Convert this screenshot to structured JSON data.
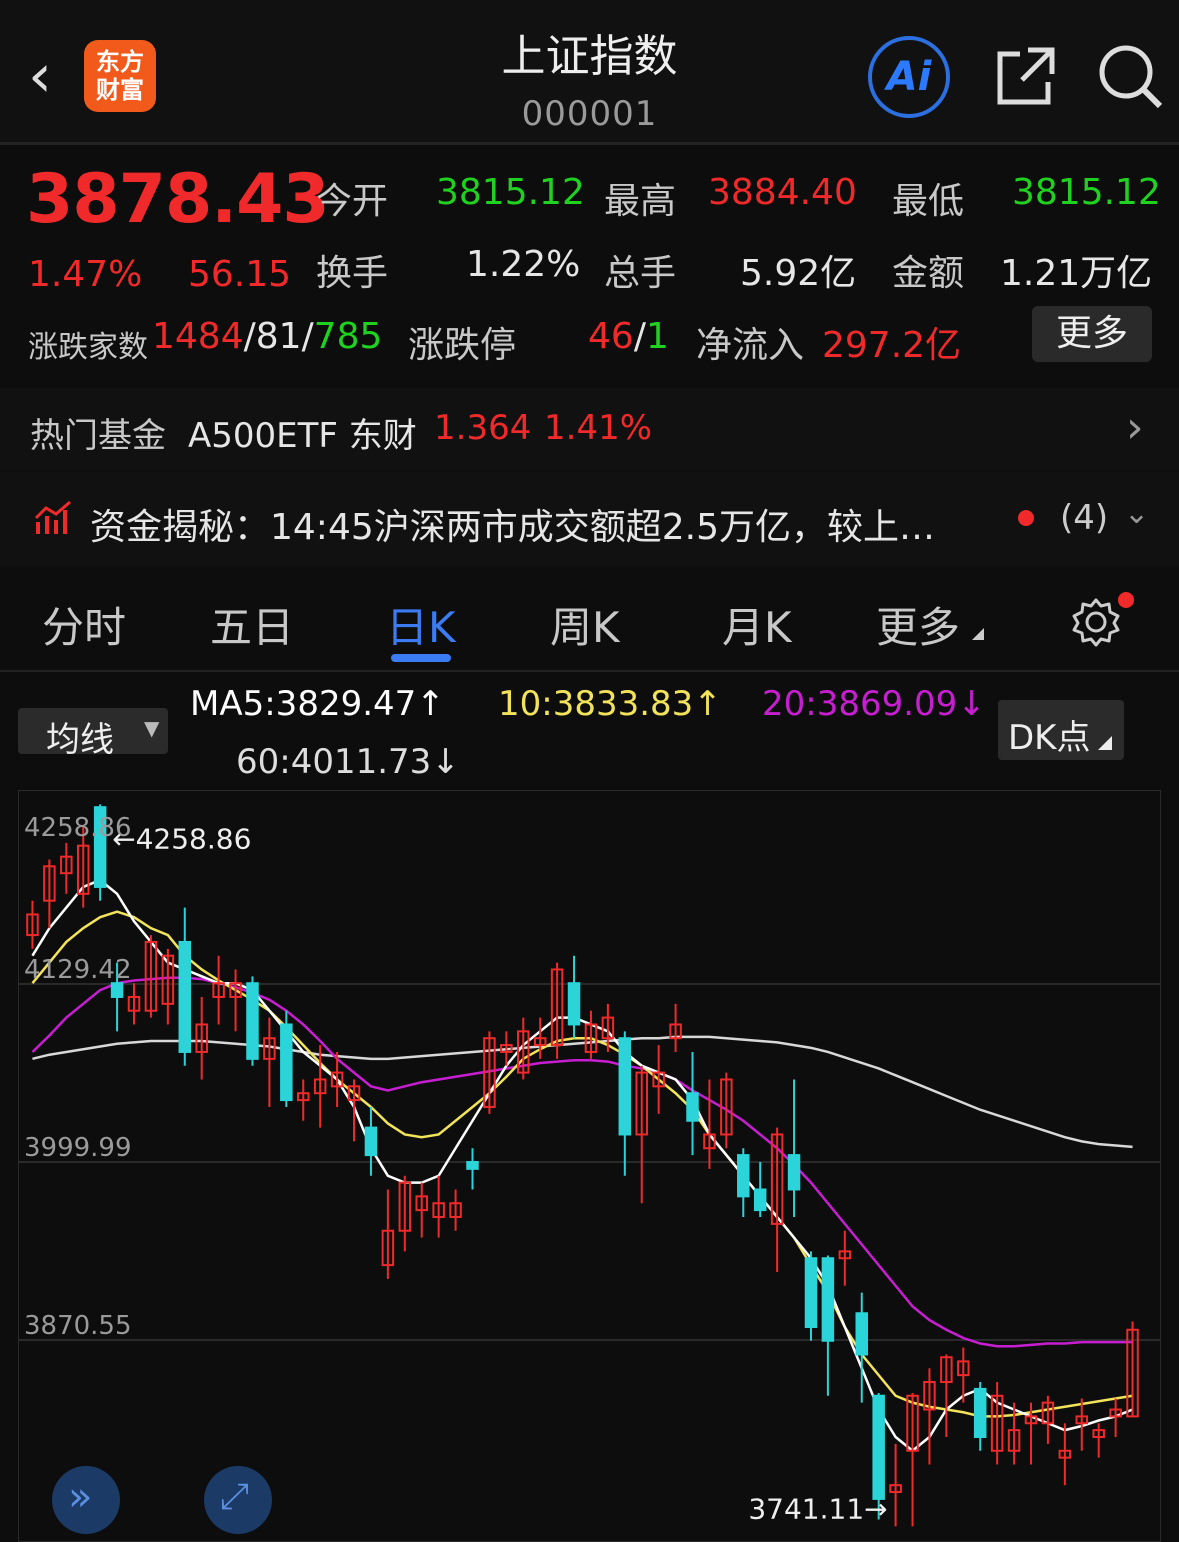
{
  "header": {
    "title": "上证指数",
    "code": "000001",
    "logo_line1": "东方",
    "logo_line2": "财富",
    "ai_label": "Ai"
  },
  "quote": {
    "price": "3878.43",
    "change_pct": "1.47%",
    "change": "56.15",
    "open_label": "今开",
    "open": "3815.12",
    "high_label": "最高",
    "high": "3884.40",
    "low_label": "最低",
    "low": "3815.12",
    "turnover_label": "换手",
    "turnover": "1.22%",
    "volume_label": "总手",
    "volume": "5.92亿",
    "amount_label": "金额",
    "amount": "1.21万亿",
    "breadth_label": "涨跌家数",
    "up": "1484",
    "flat": "81",
    "down": "785",
    "limit_label": "涨跌停",
    "limit_up": "46",
    "limit_down": "1",
    "inflow_label": "净流入",
    "inflow": "297.2亿",
    "more_label": "更多",
    "sep": "/"
  },
  "fund": {
    "label": "热门基金",
    "name": "A500ETF 东财",
    "price": "1.364",
    "pct": "1.41%"
  },
  "news": {
    "text": "资金揭秘：14:45沪深两市成交额超2.5万亿，较上…",
    "count": "(4)"
  },
  "tabs": [
    "分时",
    "五日",
    "日K",
    "周K",
    "月K",
    "更多"
  ],
  "active_tab": "日K",
  "ma_bar": {
    "select_label": "均线",
    "ma5": "MA5:3829.47↑",
    "ma10": "10:3833.83↑",
    "ma20": "20:3869.09↓",
    "ma60": "60:4011.73↓",
    "dk_label": "DK点"
  },
  "colors": {
    "up": "#f02a2a",
    "down": "#2ad4d8",
    "ma5": "#ffffff",
    "ma10": "#f2e35a",
    "ma20": "#c81ed2",
    "ma60": "#d8d8d8",
    "accent": "#3b7cf2"
  },
  "chart_data": {
    "type": "candlestick",
    "y_ticks": [
      "4258.86",
      "4129.42",
      "3999.99",
      "3870.55"
    ],
    "high_marker": "←4258.86",
    "low_marker": "3741.11→",
    "ylim": [
      3741.11,
      4258.86
    ],
    "candles": [
      {
        "o": 4165,
        "c": 4180,
        "h": 4190,
        "l": 4155
      },
      {
        "o": 4190,
        "c": 4215,
        "h": 4220,
        "l": 4170
      },
      {
        "o": 4210,
        "c": 4222,
        "h": 4232,
        "l": 4195
      },
      {
        "o": 4195,
        "c": 4230,
        "h": 4245,
        "l": 4185
      },
      {
        "o": 4258,
        "c": 4200,
        "h": 4260,
        "l": 4190
      },
      {
        "o": 4130,
        "c": 4120,
        "h": 4145,
        "l": 4095
      },
      {
        "o": 4110,
        "c": 4120,
        "h": 4130,
        "l": 4100
      },
      {
        "o": 4110,
        "c": 4160,
        "h": 4165,
        "l": 4105
      },
      {
        "o": 4115,
        "c": 4150,
        "h": 4155,
        "l": 4100
      },
      {
        "o": 4160,
        "c": 4080,
        "h": 4185,
        "l": 4070
      },
      {
        "o": 4080,
        "c": 4100,
        "h": 4120,
        "l": 4060
      },
      {
        "o": 4120,
        "c": 4130,
        "h": 4150,
        "l": 4100
      },
      {
        "o": 4120,
        "c": 4130,
        "h": 4140,
        "l": 4095
      },
      {
        "o": 4130,
        "c": 4075,
        "h": 4135,
        "l": 4070
      },
      {
        "o": 4075,
        "c": 4090,
        "h": 4105,
        "l": 4040
      },
      {
        "o": 4100,
        "c": 4045,
        "h": 4110,
        "l": 4040
      },
      {
        "o": 4045,
        "c": 4050,
        "h": 4060,
        "l": 4030
      },
      {
        "o": 4050,
        "c": 4060,
        "h": 4085,
        "l": 4025
      },
      {
        "o": 4055,
        "c": 4065,
        "h": 4080,
        "l": 4040
      },
      {
        "o": 4045,
        "c": 4055,
        "h": 4060,
        "l": 4015
      },
      {
        "o": 4025,
        "c": 4005,
        "h": 4040,
        "l": 3990
      },
      {
        "o": 3925,
        "c": 3950,
        "h": 3980,
        "l": 3915
      },
      {
        "o": 3950,
        "c": 3985,
        "h": 3990,
        "l": 3935
      },
      {
        "o": 3965,
        "c": 3975,
        "h": 3985,
        "l": 3945
      },
      {
        "o": 3960,
        "c": 3970,
        "h": 3990,
        "l": 3945
      },
      {
        "o": 3960,
        "c": 3970,
        "h": 3980,
        "l": 3950
      },
      {
        "o": 4000,
        "c": 3995,
        "h": 4010,
        "l": 3980
      },
      {
        "o": 4040,
        "c": 4090,
        "h": 4095,
        "l": 4035
      },
      {
        "o": 4080,
        "c": 4085,
        "h": 4095,
        "l": 4070
      },
      {
        "o": 4065,
        "c": 4095,
        "h": 4105,
        "l": 4060
      },
      {
        "o": 4085,
        "c": 4090,
        "h": 4105,
        "l": 4075
      },
      {
        "o": 4085,
        "c": 4140,
        "h": 4145,
        "l": 4075
      },
      {
        "o": 4130,
        "c": 4100,
        "h": 4150,
        "l": 4090
      },
      {
        "o": 4080,
        "c": 4100,
        "h": 4110,
        "l": 4075
      },
      {
        "o": 4090,
        "c": 4105,
        "h": 4115,
        "l": 4080
      },
      {
        "o": 4090,
        "c": 4020,
        "h": 4095,
        "l": 3990
      },
      {
        "o": 4020,
        "c": 4065,
        "h": 4070,
        "l": 3970
      },
      {
        "o": 4055,
        "c": 4065,
        "h": 4085,
        "l": 4035
      },
      {
        "o": 4090,
        "c": 4100,
        "h": 4115,
        "l": 4080
      },
      {
        "o": 4050,
        "c": 4030,
        "h": 4080,
        "l": 4005
      },
      {
        "o": 4010,
        "c": 4020,
        "h": 4060,
        "l": 3995
      },
      {
        "o": 4020,
        "c": 4060,
        "h": 4065,
        "l": 4010
      },
      {
        "o": 4005,
        "c": 3975,
        "h": 4010,
        "l": 3960
      },
      {
        "o": 3980,
        "c": 3965,
        "h": 4000,
        "l": 3960
      },
      {
        "o": 3955,
        "c": 4020,
        "h": 4025,
        "l": 3920
      },
      {
        "o": 4005,
        "c": 3980,
        "h": 4060,
        "l": 3960
      },
      {
        "o": 3930,
        "c": 3880,
        "h": 3935,
        "l": 3870
      },
      {
        "o": 3930,
        "c": 3870,
        "h": 3932,
        "l": 3830
      },
      {
        "o": 3930,
        "c": 3935,
        "h": 3950,
        "l": 3910
      },
      {
        "o": 3890,
        "c": 3860,
        "h": 3905,
        "l": 3825
      },
      {
        "o": 3830,
        "c": 3755,
        "h": 3832,
        "l": 3740
      },
      {
        "o": 3760,
        "c": 3765,
        "h": 3795,
        "l": 3735
      },
      {
        "o": 3790,
        "c": 3830,
        "h": 3832,
        "l": 3735
      },
      {
        "o": 3820,
        "c": 3840,
        "h": 3850,
        "l": 3780
      },
      {
        "o": 3840,
        "c": 3858,
        "h": 3860,
        "l": 3800
      },
      {
        "o": 3845,
        "c": 3855,
        "h": 3865,
        "l": 3825
      },
      {
        "o": 3835,
        "c": 3800,
        "h": 3840,
        "l": 3790
      },
      {
        "o": 3790,
        "c": 3830,
        "h": 3840,
        "l": 3780
      },
      {
        "o": 3790,
        "c": 3805,
        "h": 3825,
        "l": 3780
      },
      {
        "o": 3810,
        "c": 3815,
        "h": 3825,
        "l": 3780
      },
      {
        "o": 3810,
        "c": 3825,
        "h": 3830,
        "l": 3795
      },
      {
        "o": 3785,
        "c": 3790,
        "h": 3810,
        "l": 3765
      },
      {
        "o": 3810,
        "c": 3815,
        "h": 3828,
        "l": 3790
      },
      {
        "o": 3800,
        "c": 3805,
        "h": 3810,
        "l": 3785
      },
      {
        "o": 3815,
        "c": 3820,
        "h": 3828,
        "l": 3800
      },
      {
        "o": 3815,
        "c": 3878,
        "h": 3884,
        "l": 3815
      }
    ],
    "ma5": [
      4150,
      4170,
      4185,
      4200,
      4205,
      4195,
      4175,
      4160,
      4145,
      4140,
      4135,
      4130,
      4130,
      4125,
      4110,
      4095,
      4080,
      4070,
      4060,
      4040,
      4010,
      3990,
      3985,
      3985,
      3990,
      4010,
      4030,
      4050,
      4070,
      4085,
      4095,
      4105,
      4105,
      4100,
      4095,
      4080,
      4070,
      4065,
      4060,
      4045,
      4020,
      4005,
      3990,
      3975,
      3960,
      3945,
      3930,
      3910,
      3880,
      3850,
      3820,
      3800,
      3790,
      3800,
      3820,
      3830,
      3835,
      3825,
      3820,
      3815,
      3810,
      3805,
      3808,
      3812,
      3815,
      3820
    ],
    "ma10": [
      4130,
      4145,
      4160,
      4170,
      4178,
      4182,
      4178,
      4170,
      4165,
      4150,
      4140,
      4132,
      4125,
      4118,
      4110,
      4098,
      4085,
      4072,
      4060,
      4050,
      4040,
      4028,
      4020,
      4018,
      4020,
      4030,
      4040,
      4050,
      4062,
      4075,
      4082,
      4088,
      4090,
      4090,
      4085,
      4078,
      4070,
      4060,
      4050,
      4038,
      4020,
      4005,
      3990,
      3975,
      3960,
      3945,
      3925,
      3905,
      3880,
      3860,
      3845,
      3830,
      3825,
      3822,
      3820,
      3818,
      3815,
      3815,
      3816,
      3818,
      3820,
      3822,
      3824,
      3826,
      3828,
      3830
    ],
    "ma20": [
      4080,
      4092,
      4105,
      4115,
      4125,
      4130,
      4132,
      4133,
      4134,
      4134,
      4133,
      4130,
      4127,
      4123,
      4118,
      4110,
      4100,
      4088,
      4075,
      4065,
      4055,
      4052,
      4055,
      4058,
      4060,
      4062,
      4064,
      4066,
      4068,
      4070,
      4072,
      4073,
      4074,
      4074,
      4073,
      4070,
      4068,
      4065,
      4060,
      4052,
      4045,
      4038,
      4030,
      4020,
      4010,
      3998,
      3985,
      3970,
      3955,
      3940,
      3925,
      3910,
      3895,
      3885,
      3878,
      3872,
      3868,
      3866,
      3866,
      3867,
      3868,
      3868,
      3869,
      3869,
      3869,
      3869
    ],
    "ma60": [
      4075,
      4078,
      4080,
      4082,
      4084,
      4086,
      4087,
      4088,
      4088,
      4088,
      4088,
      4087,
      4086,
      4085,
      4084,
      4082,
      4080,
      4078,
      4077,
      4076,
      4075,
      4075,
      4076,
      4077,
      4078,
      4079,
      4080,
      4081,
      4082,
      4083,
      4084,
      4085,
      4086,
      4087,
      4088,
      4089,
      4090,
      4090,
      4091,
      4091,
      4091,
      4090,
      4089,
      4088,
      4087,
      4085,
      4083,
      4080,
      4076,
      4072,
      4068,
      4063,
      4058,
      4053,
      4048,
      4043,
      4038,
      4034,
      4030,
      4026,
      4022,
      4018,
      4015,
      4013,
      4012,
      4011
    ]
  }
}
